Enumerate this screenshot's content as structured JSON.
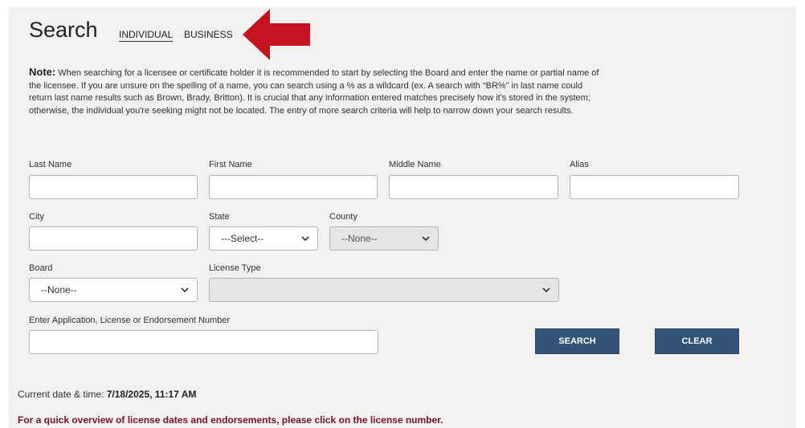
{
  "header": {
    "title": "Search",
    "tabs": [
      {
        "label": "INDIVIDUAL",
        "active": true
      },
      {
        "label": "BUSINESS",
        "active": false
      }
    ]
  },
  "note": {
    "label": "Note:",
    "text": "When searching for a licensee or certificate holder it is recommended to start by selecting the Board and enter the name or partial name of the licensee. If you are unsure on the spelling of a name, you can search using a % as a wildcard (ex. A search with “BR%” in last name could return last name results such as Brown, Brady, Britton). It is crucial that any information entered matches precisely how it's stored in the system; otherwise, the individual you're seeking might not be located. The entry of more search criteria will help to narrow down your search results."
  },
  "form": {
    "last_name_label": "Last Name",
    "first_name_label": "First Name",
    "middle_name_label": "Middle Name",
    "alias_label": "Alias",
    "city_label": "City",
    "state_label": "State",
    "state_value": "---Select--",
    "county_label": "County",
    "county_value": "--None--",
    "board_label": "Board",
    "board_value": "--None--",
    "license_type_label": "License Type",
    "license_type_value": "",
    "number_label": "Enter Application, License or Endorsement Number"
  },
  "buttons": {
    "search": "SEARCH",
    "clear": "CLEAR"
  },
  "footer": {
    "datetime_label": "Current date & time:",
    "datetime_value": "7/18/2025, 11:17 AM",
    "overview": "For a quick overview of license dates and endorsements, please click on the license number."
  },
  "colors": {
    "panel_bg": "#f2f1ef",
    "button_bg": "#325578",
    "arrow": "#c3141f",
    "overview_text": "#7a1424"
  },
  "icons": [
    "arrow-icon",
    "chevron-down-icon"
  ]
}
